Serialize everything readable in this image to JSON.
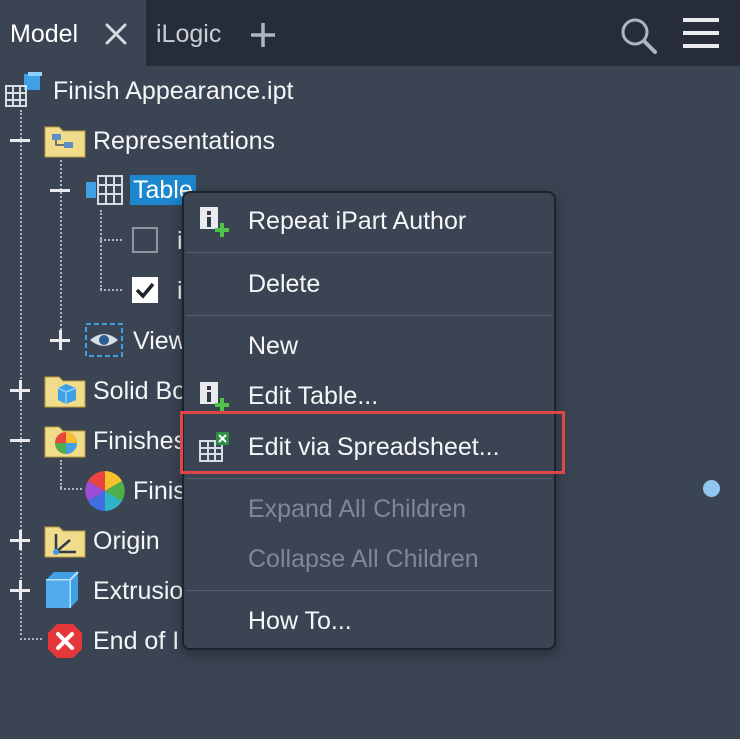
{
  "tabs": {
    "model_label": "Model",
    "ilogic_label": "iLogic"
  },
  "tree": {
    "root_label": "Finish Appearance.ipt",
    "representations_label": "Representations",
    "table_label": "Table",
    "child1_label": "i",
    "child2_label": "i",
    "view_label": "View",
    "solid_bodies_label": "Solid Bo",
    "finishes_label": "Finishes",
    "finish_item_label": "Finis",
    "origin_label": "Origin",
    "extrusion_label": "Extrusio",
    "end_of_part_label": "End of I"
  },
  "context_menu": {
    "items": [
      {
        "label": "Repeat iPart Author",
        "enabled": true
      },
      {
        "label": "Delete",
        "enabled": true
      },
      {
        "label": "New",
        "enabled": true
      },
      {
        "label": "Edit Table...",
        "enabled": true
      },
      {
        "label": "Edit via Spreadsheet...",
        "enabled": true
      },
      {
        "label": "Expand All Children",
        "enabled": false
      },
      {
        "label": "Collapse All Children",
        "enabled": false
      },
      {
        "label": "How To...",
        "enabled": true
      }
    ],
    "highlighted_item": "Edit via Spreadsheet..."
  },
  "colors": {
    "background": "#3b4453",
    "tab_bar": "#262d38",
    "selection": "#1c86cf",
    "highlight_border": "#e04646",
    "disabled_text": "#7f8896",
    "indicator_dot": "#92c5f0"
  },
  "icons": [
    "close-icon",
    "add-icon",
    "search-icon",
    "menu-icon",
    "part-icon",
    "folder-icon",
    "table-icon",
    "eye-icon",
    "solid-body-icon",
    "appearance-icon",
    "origin-icon",
    "extrusion-icon",
    "error-icon",
    "ipart-author-icon",
    "spreadsheet-icon"
  ]
}
